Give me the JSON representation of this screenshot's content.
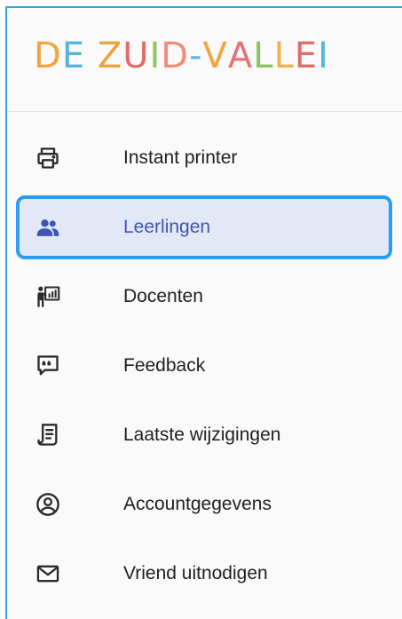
{
  "logo": {
    "letters": [
      {
        "ch": "D",
        "color": "#f2a340"
      },
      {
        "ch": "E",
        "color": "#54b6d6"
      },
      {
        "ch": " ",
        "color": "#000000"
      },
      {
        "ch": "Z",
        "color": "#e9a43c"
      },
      {
        "ch": "U",
        "color": "#e26b6b"
      },
      {
        "ch": "I",
        "color": "#8fc463"
      },
      {
        "ch": "D",
        "color": "#ef8e7a"
      },
      {
        "ch": "-",
        "color": "#5bb7d9"
      },
      {
        "ch": "V",
        "color": "#f0a640"
      },
      {
        "ch": "A",
        "color": "#e7707a"
      },
      {
        "ch": "L",
        "color": "#8bc45f"
      },
      {
        "ch": "L",
        "color": "#f3b04a"
      },
      {
        "ch": "E",
        "color": "#e26b6b"
      },
      {
        "ch": "I",
        "color": "#55b5d8"
      }
    ]
  },
  "menu": {
    "items": [
      {
        "label": "Instant printer",
        "icon": "printer-icon",
        "active": false
      },
      {
        "label": "Leerlingen",
        "icon": "people-icon",
        "active": true
      },
      {
        "label": "Docenten",
        "icon": "teacher-icon",
        "active": false
      },
      {
        "label": "Feedback",
        "icon": "feedback-icon",
        "active": false
      },
      {
        "label": "Laatste wijzigingen",
        "icon": "document-list-icon",
        "active": false
      },
      {
        "label": "Accountgegevens",
        "icon": "account-circle-icon",
        "active": false
      },
      {
        "label": "Vriend uitnodigen",
        "icon": "mail-icon",
        "active": false
      }
    ]
  },
  "colors": {
    "accent": "#2a9df4",
    "active_bg": "#e3e8f6",
    "active_text": "#3d56b8",
    "icon": "#2b2b2b"
  }
}
